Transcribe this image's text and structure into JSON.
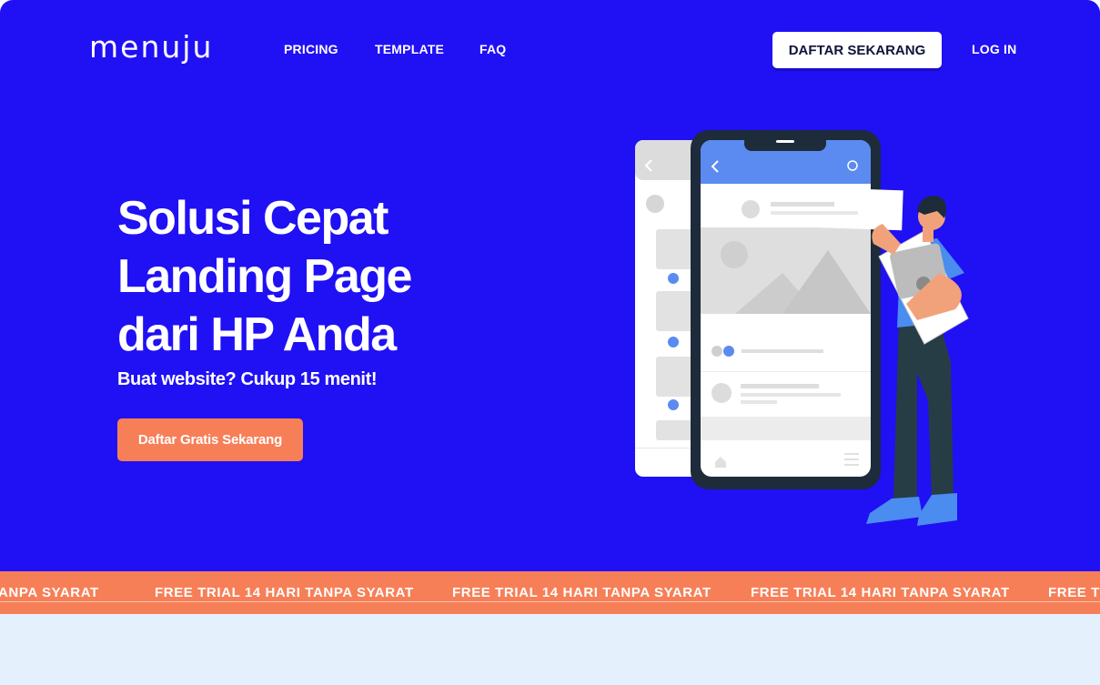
{
  "brand": {
    "logo": "menuju"
  },
  "nav": {
    "links": [
      "PRICING",
      "TEMPLATE",
      "FAQ"
    ],
    "signup_label": "DAFTAR SEKARANG",
    "login_label": "LOG IN"
  },
  "hero": {
    "headline_lines": [
      "Solusi Cepat",
      "Landing Page",
      "dari HP Anda"
    ],
    "subheadline": "Buat website? Cukup 15 menit!",
    "cta_label": "Daftar Gratis Sekarang",
    "illustration": "person-holding-phone-mockup-illustration"
  },
  "ticker": {
    "items": [
      "ANPA SYARAT",
      "FREE TRIAL 14 HARI TANPA SYARAT",
      "FREE TRIAL 14 HARI TANPA SYARAT",
      "FREE TRIAL 14 HARI TANPA SYARAT",
      "FREE TR"
    ]
  },
  "colors": {
    "hero_bg": "#2010f4",
    "accent_orange": "#f77f57",
    "section_bg": "#e4f1fc",
    "white": "#ffffff"
  }
}
